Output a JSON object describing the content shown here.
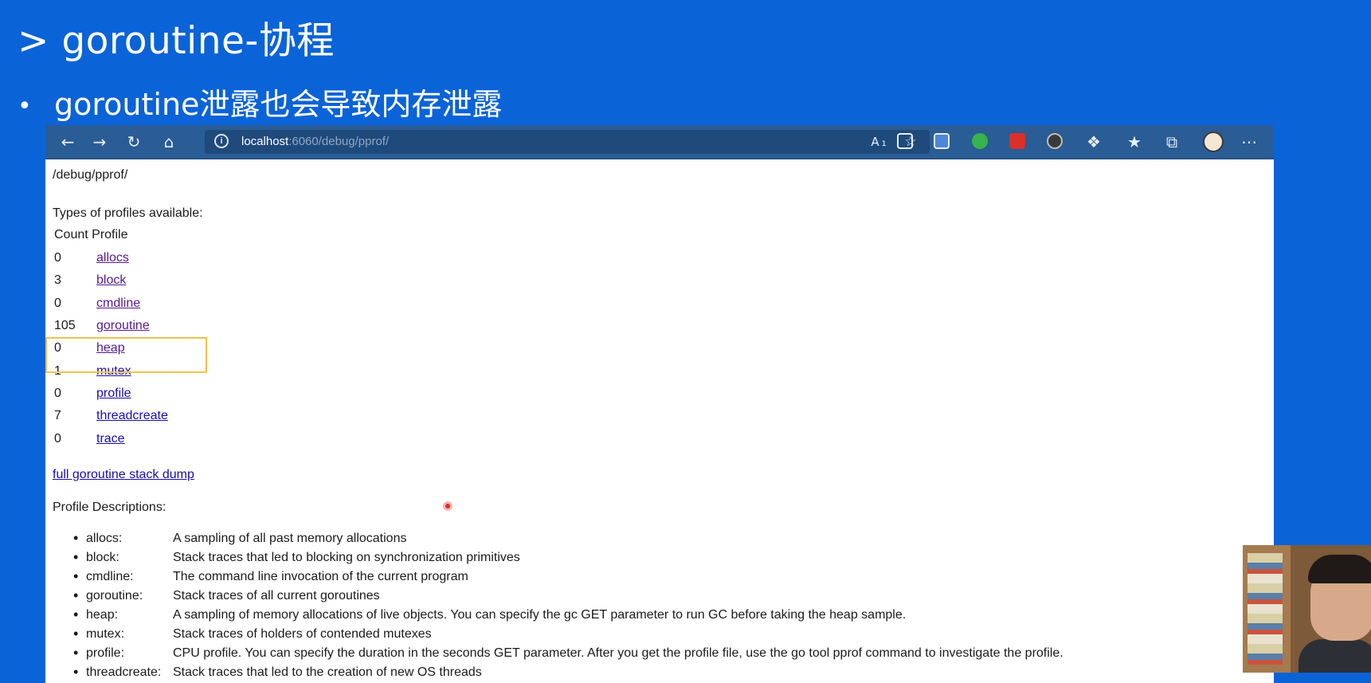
{
  "slide": {
    "title": "> goroutine-协程",
    "bullet_symbol": "•",
    "bullet_text": "goroutine泄露也会导致内存泄露"
  },
  "browser": {
    "url_host": "localhost",
    "url_path": ":6060/debug/pprof/",
    "icons": [
      "back-arrow-icon",
      "forward-arrow-icon",
      "refresh-icon",
      "home-icon",
      "site-info-icon",
      "read-aloud-icon",
      "add-favorite-icon",
      "reading-list-icon",
      "extension-shield-icon",
      "extension-green-icon",
      "extension-red-icon",
      "extension-dark-icon",
      "extensions-puzzle-icon",
      "favorites-icon",
      "collections-icon",
      "profile-avatar",
      "more-menu-icon"
    ]
  },
  "page": {
    "path": "/debug/pprof/",
    "types_heading": "Types of profiles available:",
    "count_header": "Count Profile",
    "profiles": [
      {
        "count": "0",
        "name": "allocs",
        "visited": true
      },
      {
        "count": "3",
        "name": "block",
        "visited": true
      },
      {
        "count": "0",
        "name": "cmdline",
        "visited": true
      },
      {
        "count": "105",
        "name": "goroutine",
        "visited": true
      },
      {
        "count": "0",
        "name": "heap",
        "visited": true
      },
      {
        "count": "1",
        "name": "mutex",
        "visited": false
      },
      {
        "count": "0",
        "name": "profile",
        "visited": false
      },
      {
        "count": "7",
        "name": "threadcreate",
        "visited": false
      },
      {
        "count": "0",
        "name": "trace",
        "visited": false
      }
    ],
    "dump_link": "full goroutine stack dump",
    "desc_heading": "Profile Descriptions:",
    "descriptions": [
      {
        "name": "allocs:",
        "text": "A sampling of all past memory allocations"
      },
      {
        "name": "block:",
        "text": "Stack traces that led to blocking on synchronization primitives"
      },
      {
        "name": "cmdline:",
        "text": "The command line invocation of the current program"
      },
      {
        "name": "goroutine:",
        "text": "Stack traces of all current goroutines"
      },
      {
        "name": "heap:",
        "text": "A sampling of memory allocations of live objects. You can specify the gc GET parameter to run GC before taking the heap sample."
      },
      {
        "name": "mutex:",
        "text": "Stack traces of holders of contended mutexes"
      },
      {
        "name": "profile:",
        "text": "CPU profile. You can specify the duration in the seconds GET parameter. After you get the profile file, use the go tool pprof command to investigate the profile."
      },
      {
        "name": "threadcreate:",
        "text": "Stack traces that led to the creation of new OS threads"
      }
    ]
  },
  "colors": {
    "slide_background": "#0b63d8",
    "toolbar": "#2a5c95",
    "link": "#1a0dab",
    "visited_link": "#551a8b",
    "highlight_box": "#f0c34e"
  }
}
